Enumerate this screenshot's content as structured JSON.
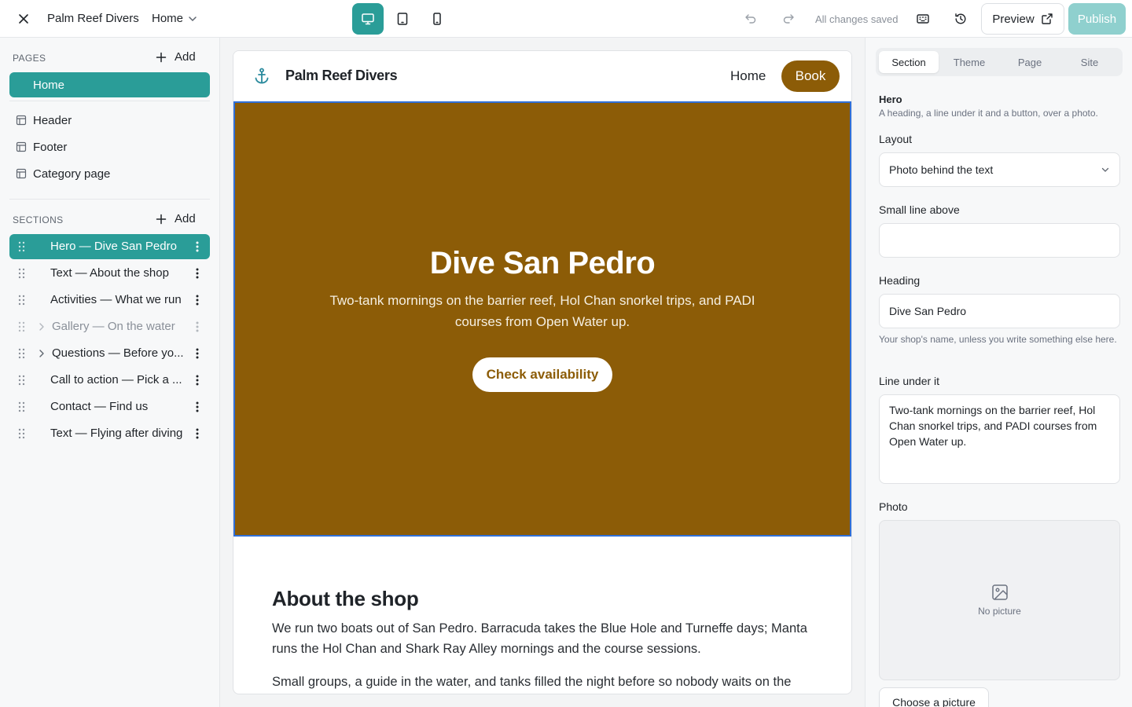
{
  "topbar": {
    "site_name": "Palm Reef Divers",
    "page_name": "Home",
    "status": "All changes saved",
    "preview_label": "Preview",
    "publish_label": "Publish"
  },
  "sidebar": {
    "pages_heading": "Pages",
    "pages_add": "Add",
    "pages": [
      {
        "label": "Home",
        "active": true
      },
      {
        "label": "Header"
      },
      {
        "label": "Footer"
      },
      {
        "label": "Category page"
      }
    ],
    "sections_heading": "Sections",
    "sections_add": "Add",
    "sections": [
      {
        "label": "Hero — Dive San Pedro",
        "active": true
      },
      {
        "label": "Text — About the shop"
      },
      {
        "label": "Activities — What we run"
      },
      {
        "label": "Gallery — On the water",
        "hidden": true,
        "expandable": true
      },
      {
        "label": "Questions — Before yo...",
        "expandable": true
      },
      {
        "label": "Call to action — Pick a ..."
      },
      {
        "label": "Contact — Find us"
      },
      {
        "label": "Text — Flying after diving"
      }
    ]
  },
  "canvas": {
    "nav": {
      "brand": "Palm Reef Divers",
      "home": "Home",
      "book": "Book"
    },
    "hero": {
      "title": "Dive San Pedro",
      "subtitle": "Two-tank mornings on the barrier reef, Hol Chan snorkel trips, and PADI courses from Open Water up.",
      "cta": "Check availability",
      "bg_color": "#8c5c07"
    },
    "about": {
      "title": "About the shop",
      "p1": "We run two boats out of San Pedro. Barracuda takes the Blue Hole and Turneffe days; Manta runs the Hol Chan and Shark Ray Alley mornings and the course sessions.",
      "p2": "Small groups, a guide in the water, and tanks filled the night before so nobody waits on the"
    }
  },
  "panel": {
    "tabs": [
      "Section",
      "Theme",
      "Page",
      "Site"
    ],
    "active_tab": "Section",
    "section_title": "Hero",
    "section_desc": "A heading, a line under it and a button, over a photo.",
    "layout_label": "Layout",
    "layout_value": "Photo behind the text",
    "small_line_label": "Small line above",
    "small_line_value": "",
    "heading_label": "Heading",
    "heading_value": "Dive San Pedro",
    "heading_help": "Your shop's name, unless you write something else here.",
    "line_under_label": "Line under it",
    "line_under_value": "Two-tank mornings on the barrier reef, Hol Chan snorkel trips, and PADI courses from Open Water up.",
    "photo_label": "Photo",
    "photo_empty": "No picture",
    "choose_label": "Choose a picture"
  },
  "colors": {
    "accent": "#2a9d98",
    "publish_disabled": "#8fd0ce",
    "brand": "#8c5c07",
    "selection": "#2f6fd8"
  },
  "icons": [
    "close-icon",
    "chevron-down-icon",
    "desktop-icon",
    "tablet-icon",
    "phone-icon",
    "undo-icon",
    "redo-icon",
    "keyboard-icon",
    "history-icon",
    "external-link-icon",
    "plus-icon",
    "layout-icon",
    "drag-handle-icon",
    "chevron-right-icon",
    "more-vertical-icon",
    "anchor-icon",
    "image-icon"
  ]
}
